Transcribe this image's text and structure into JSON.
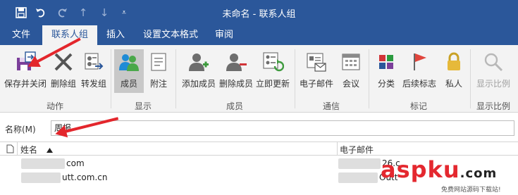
{
  "title": "未命名 - 联系人组",
  "quick_access": [
    "save-icon",
    "undo-icon",
    "redo-icon",
    "up-icon",
    "down-icon",
    "customize-icon"
  ],
  "tabs": [
    {
      "label": "文件",
      "active": false
    },
    {
      "label": "联系人组",
      "active": true
    },
    {
      "label": "插入",
      "active": false
    },
    {
      "label": "设置文本格式",
      "active": false
    },
    {
      "label": "审阅",
      "active": false
    }
  ],
  "ribbon": {
    "groups": {
      "actions": "动作",
      "show": "显示",
      "members": "成员",
      "communicate": "通信",
      "tags": "标记",
      "zoom": "显示比例"
    },
    "buttons": {
      "save_close": "保存并关闭",
      "delete_group": "删除组",
      "forward_group": "转发组",
      "members": "成员",
      "notes": "附注",
      "add_members": "添加成员",
      "remove_member": "删除成员",
      "update_now": "立即更新",
      "email": "电子邮件",
      "meeting": "会议",
      "categorize": "分类",
      "follow_up": "后续标志",
      "private": "私人",
      "zoom": "显示比例"
    }
  },
  "name_field": {
    "label": "名称(M)",
    "value": "周报"
  },
  "table": {
    "columns": [
      "姓名",
      "电子邮件"
    ],
    "rows": [
      {
        "name": "com",
        "email": "26.c"
      },
      {
        "name": "utt.com.cn",
        "email": "Outt"
      }
    ]
  },
  "watermark": {
    "brand": "aspku",
    "tld": ".com",
    "tagline": "免费网站源码下载站!"
  },
  "colors": {
    "accent": "#2b579a",
    "ribbon_bg": "#f3f3f3",
    "annotation": "#e3262c"
  }
}
